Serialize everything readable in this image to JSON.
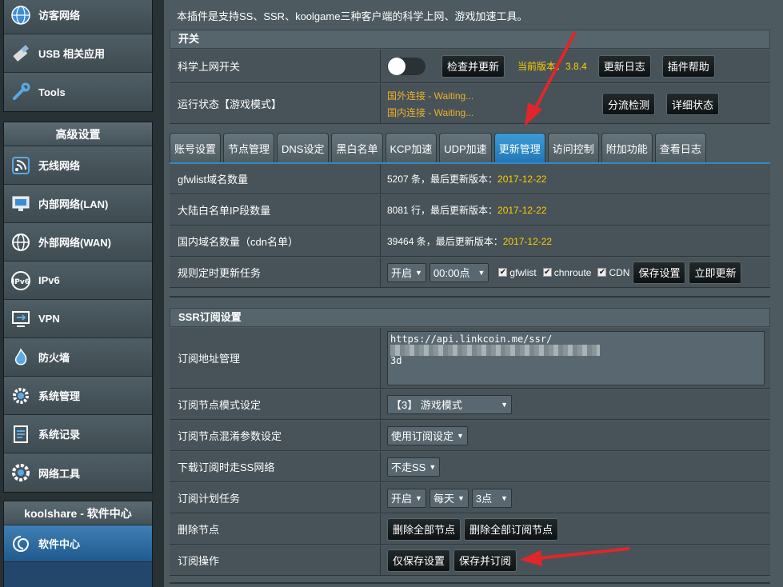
{
  "sidebar": {
    "top_items": [
      {
        "label": "访客网络",
        "icon": "globe-icon"
      },
      {
        "label": "USB 相关应用",
        "icon": "usb-icon"
      },
      {
        "label": "Tools",
        "icon": "wrench-icon"
      }
    ],
    "advanced_title": "高级设置",
    "advanced_items": [
      {
        "label": "无线网络",
        "icon": "wireless-icon"
      },
      {
        "label": "内部网络(LAN)",
        "icon": "lan-icon"
      },
      {
        "label": "外部网络(WAN)",
        "icon": "wan-globe-icon"
      },
      {
        "label": "IPv6",
        "icon": "ipv6-icon"
      },
      {
        "label": "VPN",
        "icon": "vpn-icon"
      },
      {
        "label": "防火墙",
        "icon": "firewall-icon"
      },
      {
        "label": "系统管理",
        "icon": "gear-icon"
      },
      {
        "label": "系统记录",
        "icon": "log-icon"
      },
      {
        "label": "网络工具",
        "icon": "tools-gear-icon"
      }
    ],
    "koolshare_title": "koolshare - 软件中心",
    "software_center": {
      "label": "软件中心",
      "icon": "swirl-icon"
    }
  },
  "main": {
    "intro": "本插件是支持SS、SSR、koolgame三种客户端的科学上网、游戏加速工具。",
    "switch_section": {
      "title": "开关",
      "proxy_switch_label": "科学上网开关",
      "check_update_btn": "检查并更新",
      "version_text": "当前版本：3.8.4",
      "changelog_btn": "更新日志",
      "help_btn": "插件帮助",
      "status_label": "运行状态【游戏模式】",
      "status_foreign": "国外连接 - Waiting...",
      "status_domestic": "国内连接 - Waiting...",
      "split_check_btn": "分流检测",
      "detail_status_btn": "详细状态"
    },
    "tabs": [
      "账号设置",
      "节点管理",
      "DNS设定",
      "黑白名单",
      "KCP加速",
      "UDP加速",
      "更新管理",
      "访问控制",
      "附加功能",
      "查看日志"
    ],
    "active_tab": "更新管理",
    "update": {
      "gfwlist_label": "gfwlist域名数量",
      "gfwlist_prefix": "5207 条，最后更新版本：",
      "gfwlist_date": "2017-12-22",
      "chnroute_label": "大陆白名单IP段数量",
      "chnroute_prefix": "8081 行，最后更新版本：",
      "chnroute_date": "2017-12-22",
      "cdn_label": "国内域名数量（cdn名单）",
      "cdn_prefix": "39464 条，最后更新版本：",
      "cdn_date": "2017-12-22",
      "schedule_label": "规则定时更新任务",
      "schedule_enable": "开启",
      "schedule_time": "00:00点",
      "chk_gfwlist": "gfwlist",
      "chk_chnroute": "chnroute",
      "chk_cdn": "CDN",
      "save_btn": "保存设置",
      "update_now_btn": "立即更新"
    },
    "ssr": {
      "title": "SSR订阅设置",
      "url_label": "订阅地址管理",
      "url_value_visible": "https://api.linkcoin.me/ssr/",
      "url_value_line2": "3d",
      "mode_label": "订阅节点模式设定",
      "mode_value": "【3】 游戏模式",
      "obfs_label": "订阅节点混淆参数设定",
      "obfs_value": "使用订阅设定",
      "download_label": "下载订阅时走SS网络",
      "download_value": "不走SS",
      "plan_label": "订阅计划任务",
      "plan_enable": "开启",
      "plan_freq": "每天",
      "plan_hour": "3点",
      "delete_label": "删除节点",
      "delete_all_btn": "删除全部节点",
      "delete_sub_btn": "删除全部订阅节点",
      "op_label": "订阅操作",
      "save_only_btn": "仅保存设置",
      "save_sub_btn": "保存并订阅"
    }
  },
  "colors": {
    "arrow": "#e0262a",
    "accent": "#2f86c8",
    "status": "#f0ad2c"
  }
}
